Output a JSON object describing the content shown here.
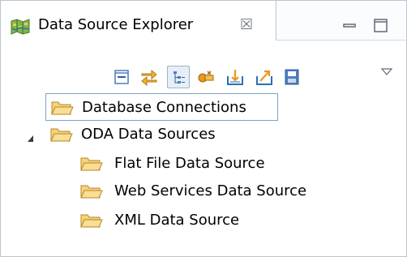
{
  "view": {
    "tab_title": "Data Source Explorer",
    "tab_close_glyph": "☒",
    "minimize_icon": "minimize-icon",
    "maximize_icon": "maximize-icon"
  },
  "toolbar": {
    "buttons": [
      {
        "icon": "collapse-all-icon"
      },
      {
        "icon": "link-with-editor-icon"
      },
      {
        "icon": "show-category-icon",
        "pressed": true
      },
      {
        "icon": "connect-icon"
      },
      {
        "icon": "import-icon"
      },
      {
        "icon": "export-icon"
      },
      {
        "icon": "save-icon"
      }
    ],
    "view_menu_icon": "view-menu-icon"
  },
  "tree": {
    "items": [
      {
        "label": "Database Connections",
        "level": 0,
        "expanded": false,
        "selected": true
      },
      {
        "label": "ODA Data Sources",
        "level": 0,
        "expanded": true,
        "selected": false
      },
      {
        "label": "Flat File Data Source",
        "level": 1,
        "expanded": false,
        "selected": false
      },
      {
        "label": "Web Services Data Source",
        "level": 1,
        "expanded": false,
        "selected": false
      },
      {
        "label": "XML Data Source",
        "level": 1,
        "expanded": false,
        "selected": false
      }
    ]
  },
  "colors": {
    "folder_fill": "#f6d27a",
    "folder_stroke": "#b8862b",
    "selection_border": "#7fa1c8",
    "tab_border": "#b9c6d6",
    "icon_blue": "#4a7fbf",
    "icon_orange": "#e69a1c"
  }
}
